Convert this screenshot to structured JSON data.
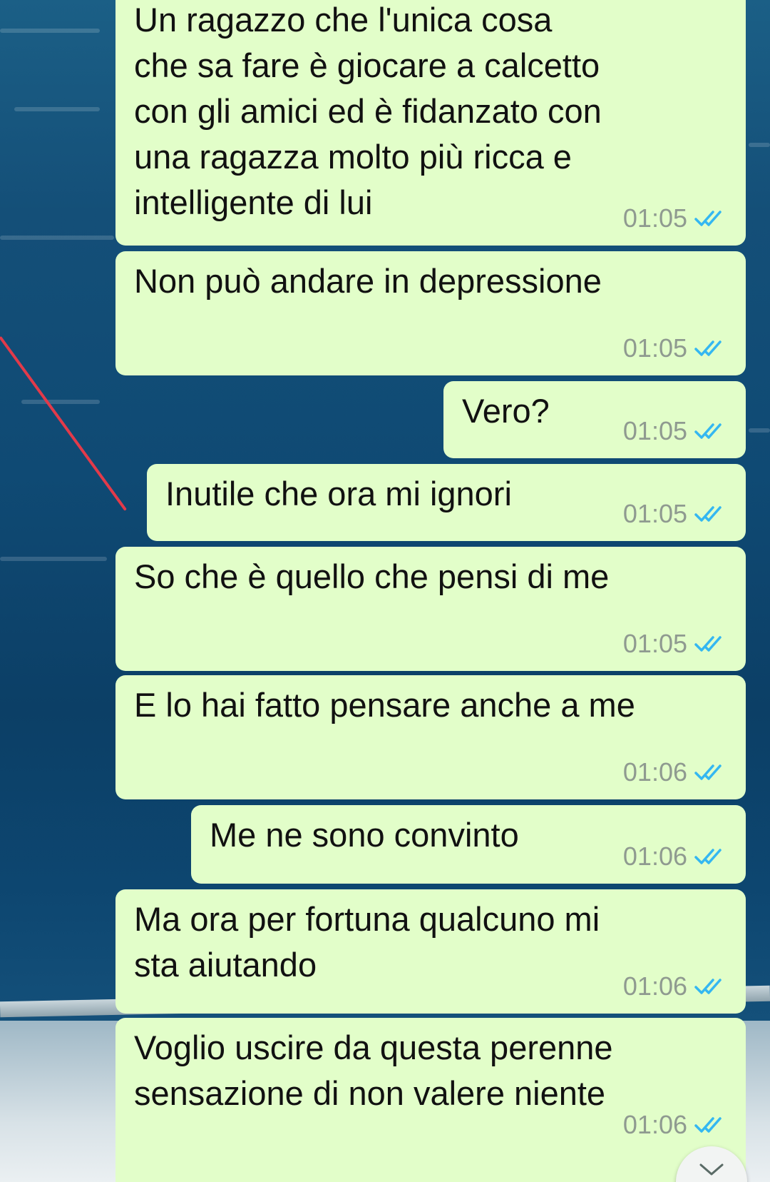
{
  "messages": [
    {
      "text": "Un ragazzo che l'unica cosa\nche sa fare è giocare a calcetto\ncon gli amici ed è fidanzato con\nuna ragazza molto più ricca e\nintelligente di lui",
      "time": "01:05",
      "status": "read"
    },
    {
      "text": "Non può andare in depressione",
      "time": "01:05",
      "status": "read"
    },
    {
      "text": "Vero?",
      "time": "01:05",
      "status": "read"
    },
    {
      "text": "Inutile che ora mi ignori",
      "time": "01:05",
      "status": "read"
    },
    {
      "text": "So che è quello che pensi di me",
      "time": "01:05",
      "status": "read"
    },
    {
      "text": "E lo hai fatto pensare anche a me",
      "time": "01:06",
      "status": "read"
    },
    {
      "text": "Me ne sono convinto",
      "time": "01:06",
      "status": "read"
    },
    {
      "text": "Ma ora per fortuna qualcuno mi\nsta aiutando",
      "time": "01:06",
      "status": "read"
    },
    {
      "text": "Voglio uscire da questa perenne\nsensazione di non valere niente",
      "time": "01:06",
      "status": "read"
    }
  ],
  "colors": {
    "bubble": "#e2fec9",
    "read_ticks": "#34b7f1",
    "timestamp": "#8f9a90"
  },
  "icons": {
    "read_receipt": "double-check-icon",
    "scroll_down": "chevron-down-icon"
  }
}
